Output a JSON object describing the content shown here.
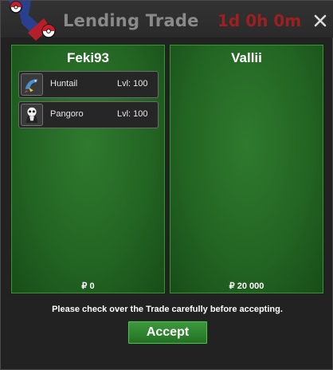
{
  "window": {
    "title": "Lending Trade",
    "timer": "1d 0h 0m",
    "close_icon": "close-icon"
  },
  "left_panel": {
    "trader": "Feki93",
    "items": [
      {
        "name": "Huntail",
        "level": "Lvl: 100",
        "icon": "huntail-sprite"
      },
      {
        "name": "Pangoro",
        "level": "Lvl: 100",
        "icon": "pangoro-sprite"
      }
    ],
    "money": "₽ 0"
  },
  "right_panel": {
    "trader": "Vallii",
    "money": "₽ 20 000"
  },
  "footer": {
    "notice": "Please check over the Trade carefully before accepting.",
    "accept_label": "Accept"
  },
  "colors": {
    "panel_green": "#236523",
    "timer_red": "#9e1f1f",
    "title_gray": "#8a8a8a",
    "background": "#222222"
  }
}
